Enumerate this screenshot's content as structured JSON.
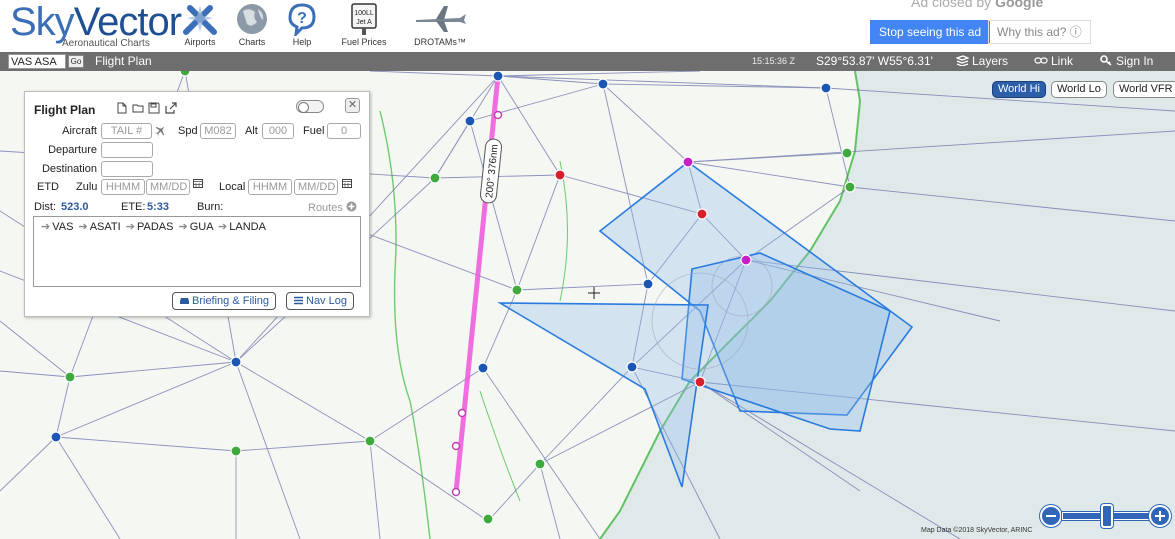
{
  "header": {
    "logo_text": "SkyVector",
    "logo_tagline": "Aeronautical Charts",
    "nav": [
      {
        "label": "Airports",
        "icon": "airports-icon"
      },
      {
        "label": "Charts",
        "icon": "globe-icon"
      },
      {
        "label": "Help",
        "icon": "help-icon"
      },
      {
        "label": "Fuel Prices",
        "icon": "fuel-sign-icon",
        "sign_line1": "100LL",
        "sign_line2": "Jet A"
      },
      {
        "label": "DROTAMs™",
        "icon": "drone-icon"
      }
    ],
    "ad": {
      "closed_by": "Ad closed by",
      "closed_by_brand": "Google",
      "stop_label": "Stop seeing this ad",
      "why_label": "Why this ad? ⓘ",
      "stop_color": "#4285f4"
    }
  },
  "topbar": {
    "search_value": "VAS ASA",
    "go_label": "Go",
    "flight_plan_label": "Flight Plan",
    "clock": "15:15:36 Z",
    "coords": "S29°53.87' W55°6.31'",
    "layers_label": "Layers",
    "link_label": "Link",
    "signin_label": "Sign In"
  },
  "map": {
    "chart_buttons": [
      "World Hi",
      "World Lo",
      "World VFR"
    ],
    "active_chart": "World Hi",
    "route_label": "200° 376nm",
    "attribution": "Map Data ©2018 SkyVector, ARINC",
    "colors": {
      "route": "#ee55dd",
      "airway": "#6a6fa8",
      "airspace": "#2a7be0",
      "ocean": "#dde9ea",
      "land": "#f4f7f2",
      "coast": "#5cc05c"
    }
  },
  "flight_plan": {
    "title": "Flight Plan",
    "aircraft_label": "Aircraft",
    "tail_placeholder": "TAIL #",
    "spd_label": "Spd",
    "spd_placeholder": "M082",
    "alt_label": "Alt",
    "alt_placeholder": "000",
    "fuel_label": "Fuel",
    "fuel_placeholder": "0",
    "departure_label": "Departure",
    "destination_label": "Destination",
    "etd_label": "ETD",
    "zulu_label": "Zulu",
    "local_label": "Local",
    "time_placeholder": "HHMM",
    "date_placeholder": "MM/DD",
    "dist_label": "Dist:",
    "dist_value": "523.0",
    "ete_label": "ETE:",
    "ete_value": "5:33",
    "burn_label": "Burn:",
    "routes_label": "Routes",
    "route": [
      "VAS",
      "ASATI",
      "PADAS",
      "GUA",
      "LANDA"
    ],
    "briefing_label": "Briefing & Filing",
    "navlog_label": "Nav Log"
  }
}
